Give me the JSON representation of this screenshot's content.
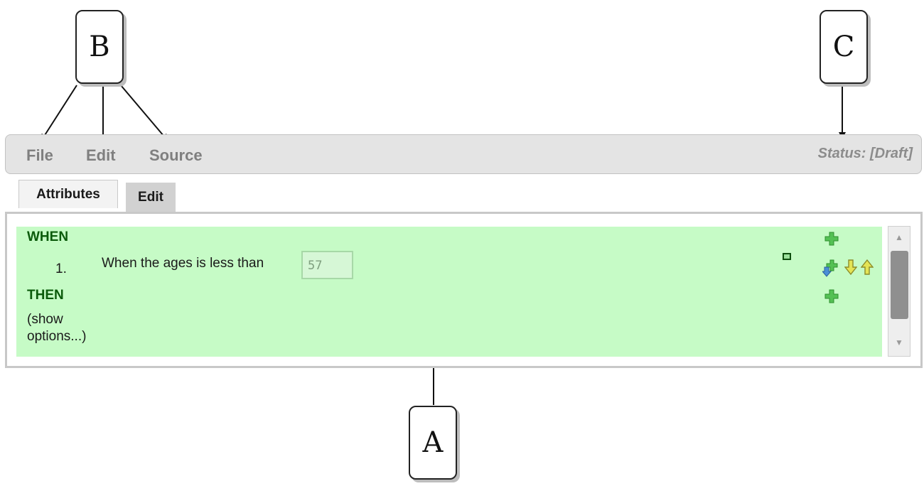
{
  "callouts": {
    "a": "A",
    "b": "B",
    "c": "C"
  },
  "menubar": {
    "items": [
      {
        "label": "File"
      },
      {
        "label": "Edit"
      },
      {
        "label": "Source"
      }
    ],
    "status": "Status: [Draft]"
  },
  "tabs": [
    {
      "label": "Attributes"
    },
    {
      "label": "Edit"
    }
  ],
  "rule": {
    "when_label": "WHEN",
    "conditions": [
      {
        "number": "1.",
        "text": "When the ages is less than",
        "value": "57"
      }
    ],
    "then_label": "THEN",
    "options_label": "(show options...)"
  },
  "icons": [
    "add-condition-icon",
    "remove-condition-icon",
    "insert-condition-icon",
    "move-down-icon",
    "move-up-icon",
    "add-action-icon",
    "scroll-up-icon",
    "scroll-down-icon"
  ],
  "colors": {
    "rule_background": "#c6fbc6",
    "keyword": "#0b5a0b",
    "add_icon": "#54c154",
    "move_icon": "#e4e455"
  }
}
